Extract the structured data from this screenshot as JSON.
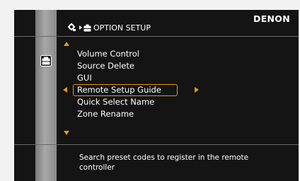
{
  "brand": "DENON",
  "header": {
    "icons": [
      "setup-icon",
      "breadcrumb-arrow-icon",
      "option-setup-icon"
    ],
    "title": "OPTION SETUP"
  },
  "side_icon": "option-setup-icon",
  "menu": {
    "items": [
      {
        "label": "Volume Control"
      },
      {
        "label": "Source Delete"
      },
      {
        "label": "GUI"
      },
      {
        "label": "Remote Setup Guide",
        "selected": true
      },
      {
        "label": "Quick Select Name"
      },
      {
        "label": "Zone Rename"
      }
    ]
  },
  "help_text": "Search preset codes to register in the remote controller",
  "colors": {
    "background": "#141414",
    "accent": "#e8960e",
    "sidebar": "#9a9a9a",
    "text": "#ffffff"
  }
}
